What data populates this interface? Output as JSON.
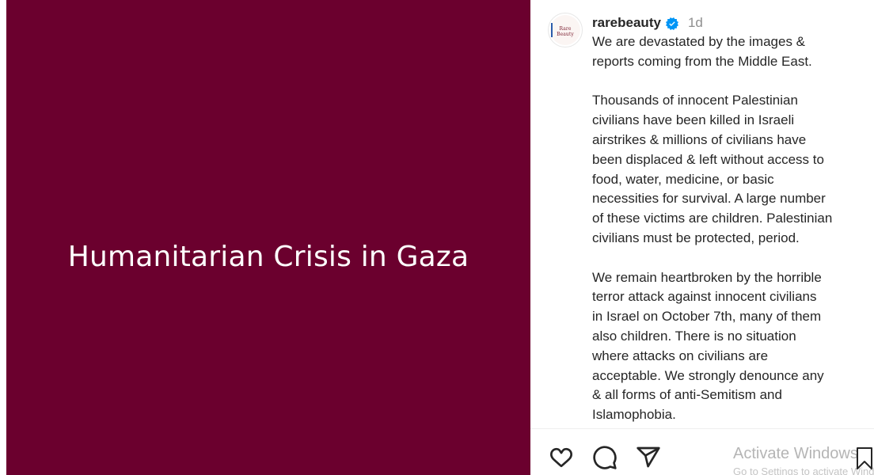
{
  "post": {
    "image_text": "Humanitarian Crisis in Gaza",
    "image_color": "#6b002e"
  },
  "author": {
    "avatar_text": "Rare Beauty",
    "username": "rarebeauty",
    "verified_icon": "verified-badge-icon",
    "time": "1d"
  },
  "caption": {
    "paragraph1": [
      "We are devastated by the images &",
      "reports coming from the Middle East."
    ],
    "paragraph2": [
      "Thousands of innocent Palestinian",
      "civilians have been killed in Israeli",
      "airstrikes & millions of civilians have",
      "been displaced & left without access to",
      "food, water, medicine, or basic",
      "necessities for survival. A large number",
      "of these victims are children. Palestinian",
      "civilians must be protected, period."
    ],
    "paragraph3": [
      "We remain heartbroken by the horrible",
      "terror attack against innocent civilians",
      "in Israel on October 7th, many of them",
      "also children. There is no situation",
      "where attacks on civilians are",
      "acceptable. We strongly denounce any",
      "& all forms of anti-Semitism and",
      "Islamophobia."
    ]
  },
  "actions": {
    "like_icon": "heart-icon",
    "comment_icon": "comment-icon",
    "share_icon": "send-icon",
    "save_icon": "bookmark-icon"
  },
  "watermark": {
    "title": "Activate Windows",
    "subtitle": "Go to Settings to activate Windows."
  }
}
